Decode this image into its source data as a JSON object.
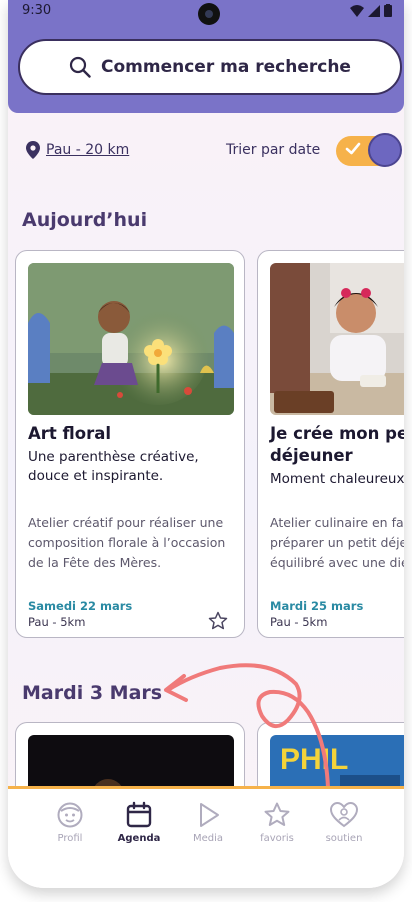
{
  "status_bar": {
    "time": "9:30"
  },
  "search": {
    "label": "Commencer ma recherche"
  },
  "filters": {
    "location": "Pau - 20 km",
    "sort_label": "Trier par date",
    "sort_by_date_enabled": true
  },
  "sections": [
    {
      "title": "Aujourd’hui",
      "cards": [
        {
          "title": "Art floral",
          "subtitle": "Une parenthèse créative, douce et inspirante.",
          "description": "Atelier créatif pour réaliser une composition florale à l’occasion de la Fête des Mères.",
          "date": "Samedi 22 mars",
          "place": "Pau - 5km"
        },
        {
          "title": "Je crée mon petit déjeuner",
          "subtitle": "Moment chaleureux à partager",
          "description": "Atelier culinaire en famille pour préparer un petit déjeuner équilibré avec une diététicienne.",
          "date": "Mardi 25 mars",
          "place": "Pau - 5km"
        }
      ]
    },
    {
      "title": "Mardi 3 Mars",
      "cards": [
        {
          "image_text": ""
        },
        {
          "image_text": "PHIL"
        }
      ]
    }
  ],
  "bottom_nav": [
    {
      "label": "Profil",
      "icon": "profile-icon",
      "active": false
    },
    {
      "label": "Agenda",
      "icon": "calendar-icon",
      "active": true
    },
    {
      "label": "Media",
      "icon": "play-icon",
      "active": false
    },
    {
      "label": "favoris",
      "icon": "star-icon",
      "active": false
    },
    {
      "label": "soutien",
      "icon": "heart-icon",
      "active": false
    }
  ],
  "colors": {
    "header": "#7a73c8",
    "accent": "#f6b24a",
    "date_text": "#2a8aa3",
    "annotation_arrow": "#f07a7a"
  }
}
